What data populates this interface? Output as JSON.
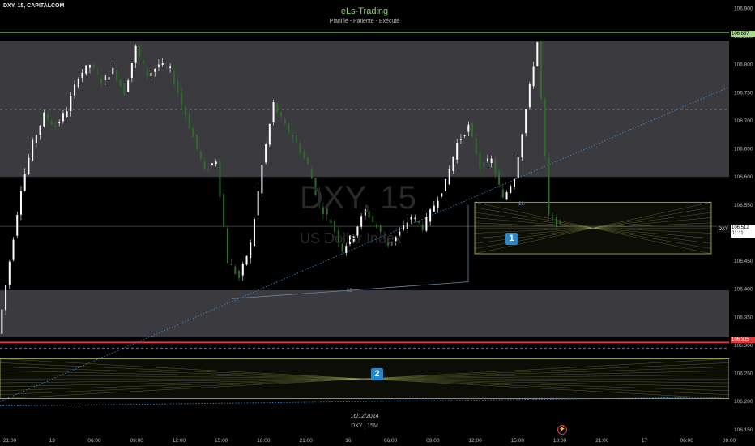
{
  "header": {
    "symbol": "DXY, 15, CAPITALCOM",
    "title": "eLs-Trading",
    "subtitle": "Planifié - Patienté - Exécuté"
  },
  "watermark": {
    "ticker": "DXY, 15",
    "name": "US Dollar Index"
  },
  "price_tags": {
    "high": "106.857",
    "red_level": "106.305",
    "last_price": "106.512",
    "last_timer": "01:11",
    "symbol_tag": "DXY"
  },
  "footer": {
    "date": "16/12/2024",
    "symbol_timeframe": "DXY | 15M"
  },
  "zones": {
    "zone_1_label": "1",
    "zone_2_label": "2"
  },
  "liquidity_labels": [
    "$$",
    "$$"
  ],
  "colors": {
    "background": "#000000",
    "zone_gray": "#3a3a3f",
    "candle_up": "#ffffff",
    "candle_down": "#2f6b2b",
    "high_line": "#7fc86a",
    "red_line": "#e0393b",
    "trendline": "#3d8fd6",
    "zone_outline": "#c8d66a",
    "label_box": "#2a86c6"
  },
  "chart_data": {
    "type": "candlestick",
    "y_axis_ticks": [
      "106.900",
      "106.850",
      "106.800",
      "106.750",
      "106.700",
      "106.650",
      "106.600",
      "106.550",
      "106.500",
      "106.450",
      "106.400",
      "106.350",
      "106.300",
      "106.250",
      "106.200",
      "106.150"
    ],
    "y_axis_tick_values": [
      106.9,
      106.85,
      106.8,
      106.75,
      106.7,
      106.65,
      106.6,
      106.55,
      106.5,
      106.45,
      106.4,
      106.35,
      106.3,
      106.25,
      106.2,
      106.15
    ],
    "x_axis_ticks": [
      "21:00",
      "13",
      "06:00",
      "09:00",
      "12:00",
      "15:00",
      "18:00",
      "21:00",
      "16",
      "06:00",
      "09:00",
      "12:00",
      "15:00",
      "18:00",
      "21:00",
      "17",
      "06:00",
      "09:00"
    ],
    "ylim": [
      106.141,
      106.915
    ],
    "levels": {
      "high": 106.857,
      "red_level": 106.305,
      "dashed_levels": [
        106.72,
        106.295
      ],
      "last_price": 106.512
    },
    "gray_zones": [
      [
        106.6,
        106.842
      ],
      [
        106.315,
        106.398
      ]
    ],
    "projection_zones": [
      {
        "label": "1",
        "top": 106.555,
        "bottom": 106.463
      },
      {
        "label": "2",
        "top": 106.276,
        "bottom": 106.205
      }
    ],
    "close_path": [
      106.32,
      106.45,
      106.58,
      106.66,
      106.71,
      106.69,
      106.72,
      106.78,
      106.8,
      106.77,
      106.79,
      106.75,
      106.83,
      106.78,
      106.8,
      106.79,
      106.73,
      106.67,
      106.61,
      106.63,
      106.45,
      106.42,
      106.48,
      106.62,
      106.73,
      106.69,
      106.66,
      106.62,
      106.55,
      106.52,
      106.47,
      106.5,
      106.54,
      106.51,
      106.48,
      106.5,
      106.53,
      106.51,
      106.55,
      106.59,
      106.66,
      106.69,
      106.62,
      106.63,
      106.56,
      106.6,
      106.72,
      106.84,
      106.53,
      106.51
    ]
  }
}
